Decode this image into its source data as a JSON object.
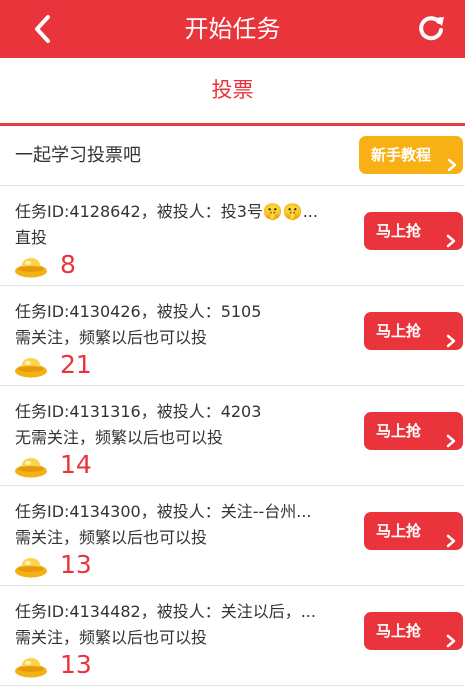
{
  "header": {
    "title": "开始任务",
    "back_icon": "chevron-left-icon",
    "refresh_icon": "refresh-icon"
  },
  "tab": {
    "label": "投票"
  },
  "intro": {
    "text": "一起学习投票吧",
    "guide_button": "新手教程"
  },
  "tasks": [
    {
      "line1": "任务ID:4128642，被投人：投3号🤫🤫...",
      "line2": "直投",
      "reward": "8",
      "button": "马上抢"
    },
    {
      "line1": "任务ID:4130426，被投人：5105",
      "line2": "需关注，频繁以后也可以投",
      "reward": "21",
      "button": "马上抢"
    },
    {
      "line1": "任务ID:4131316，被投人：4203",
      "line2": "无需关注，频繁以后也可以投",
      "reward": "14",
      "button": "马上抢"
    },
    {
      "line1": "任务ID:4134300，被投人：关注--台州...",
      "line2": "需关注，频繁以后也可以投",
      "reward": "13",
      "button": "马上抢"
    },
    {
      "line1": "任务ID:4134482，被投人：关注以后，...",
      "line2": "需关注，频繁以后也可以投",
      "reward": "13",
      "button": "马上抢"
    }
  ],
  "colors": {
    "primary": "#e9343c",
    "guide": "#f9b015",
    "coin": "#f5b114"
  }
}
